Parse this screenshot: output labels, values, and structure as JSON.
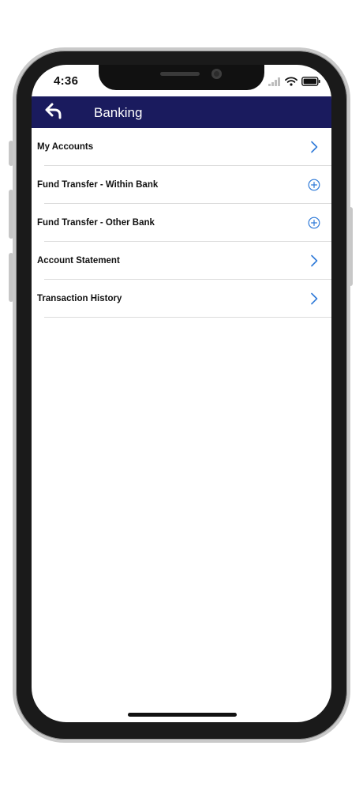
{
  "status_bar": {
    "time": "4:36"
  },
  "header": {
    "title": "Banking",
    "back_icon": "back-arrow-icon",
    "background": "#1a1b5e"
  },
  "menu": {
    "items": [
      {
        "label": "My Accounts",
        "icon": "chevron-right-icon"
      },
      {
        "label": "Fund Transfer - Within Bank",
        "icon": "plus-circle-icon"
      },
      {
        "label": "Fund Transfer - Other Bank",
        "icon": "plus-circle-icon"
      },
      {
        "label": "Account Statement",
        "icon": "chevron-right-icon"
      },
      {
        "label": "Transaction History",
        "icon": "chevron-right-icon"
      }
    ]
  },
  "colors": {
    "accent": "#2f7ad8",
    "divider": "#dcdcdc"
  }
}
